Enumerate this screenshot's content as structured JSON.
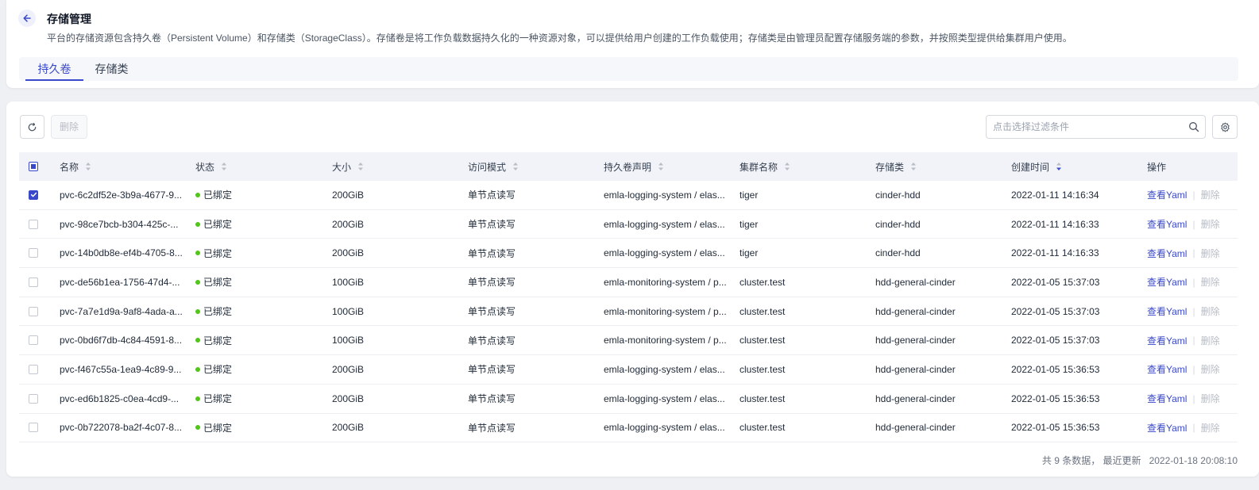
{
  "header": {
    "title": "存储管理",
    "description": "平台的存储资源包含持久卷（Persistent Volume）和存储类（StorageClass）。存储卷是将工作负载数据持久化的一种资源对象，可以提供给用户创建的工作负载使用；存储类是由管理员配置存储服务端的参数，并按照类型提供给集群用户使用。",
    "tabs": [
      {
        "label": "持久卷",
        "active": true
      },
      {
        "label": "存储类",
        "active": false
      }
    ]
  },
  "toolbar": {
    "delete_label": "删除",
    "filter_placeholder": "点击选择过滤条件"
  },
  "table": {
    "columns": [
      "名称",
      "状态",
      "大小",
      "访问模式",
      "持久卷声明",
      "集群名称",
      "存储类",
      "创建时间",
      "操作"
    ],
    "action_view": "查看Yaml",
    "action_delete": "删除",
    "rows": [
      {
        "name": "pvc-6c2df52e-3b9a-4677-9...",
        "status": "已绑定",
        "size": "200GiB",
        "mode": "单节点读写",
        "pvc": "emla-logging-system / elas...",
        "cluster": "tiger",
        "sc": "cinder-hdd",
        "time": "2022-01-11 14:16:34",
        "checked": true
      },
      {
        "name": "pvc-98ce7bcb-b304-425c-...",
        "status": "已绑定",
        "size": "200GiB",
        "mode": "单节点读写",
        "pvc": "emla-logging-system / elas...",
        "cluster": "tiger",
        "sc": "cinder-hdd",
        "time": "2022-01-11 14:16:33",
        "checked": false
      },
      {
        "name": "pvc-14b0db8e-ef4b-4705-8...",
        "status": "已绑定",
        "size": "200GiB",
        "mode": "单节点读写",
        "pvc": "emla-logging-system / elas...",
        "cluster": "tiger",
        "sc": "cinder-hdd",
        "time": "2022-01-11 14:16:33",
        "checked": false
      },
      {
        "name": "pvc-de56b1ea-1756-47d4-...",
        "status": "已绑定",
        "size": "100GiB",
        "mode": "单节点读写",
        "pvc": "emla-monitoring-system / p...",
        "cluster": "cluster.test",
        "sc": "hdd-general-cinder",
        "time": "2022-01-05 15:37:03",
        "checked": false
      },
      {
        "name": "pvc-7a7e1d9a-9af8-4ada-a...",
        "status": "已绑定",
        "size": "100GiB",
        "mode": "单节点读写",
        "pvc": "emla-monitoring-system / p...",
        "cluster": "cluster.test",
        "sc": "hdd-general-cinder",
        "time": "2022-01-05 15:37:03",
        "checked": false
      },
      {
        "name": "pvc-0bd6f7db-4c84-4591-8...",
        "status": "已绑定",
        "size": "100GiB",
        "mode": "单节点读写",
        "pvc": "emla-monitoring-system / p...",
        "cluster": "cluster.test",
        "sc": "hdd-general-cinder",
        "time": "2022-01-05 15:37:03",
        "checked": false
      },
      {
        "name": "pvc-f467c55a-1ea9-4c89-9...",
        "status": "已绑定",
        "size": "200GiB",
        "mode": "单节点读写",
        "pvc": "emla-logging-system / elas...",
        "cluster": "cluster.test",
        "sc": "hdd-general-cinder",
        "time": "2022-01-05 15:36:53",
        "checked": false
      },
      {
        "name": "pvc-ed6b1825-c0ea-4cd9-...",
        "status": "已绑定",
        "size": "200GiB",
        "mode": "单节点读写",
        "pvc": "emla-logging-system / elas...",
        "cluster": "cluster.test",
        "sc": "hdd-general-cinder",
        "time": "2022-01-05 15:36:53",
        "checked": false
      },
      {
        "name": "pvc-0b722078-ba2f-4c07-8...",
        "status": "已绑定",
        "size": "200GiB",
        "mode": "单节点读写",
        "pvc": "emla-logging-system / elas...",
        "cluster": "cluster.test",
        "sc": "hdd-general-cinder",
        "time": "2022-01-05 15:36:53",
        "checked": false
      }
    ]
  },
  "footer": {
    "summary": "共 9 条数据，  最近更新",
    "updated": "2022-01-18 20:08:10"
  },
  "colors": {
    "accent": "#3a49c9",
    "status_ok": "#52c41a"
  }
}
